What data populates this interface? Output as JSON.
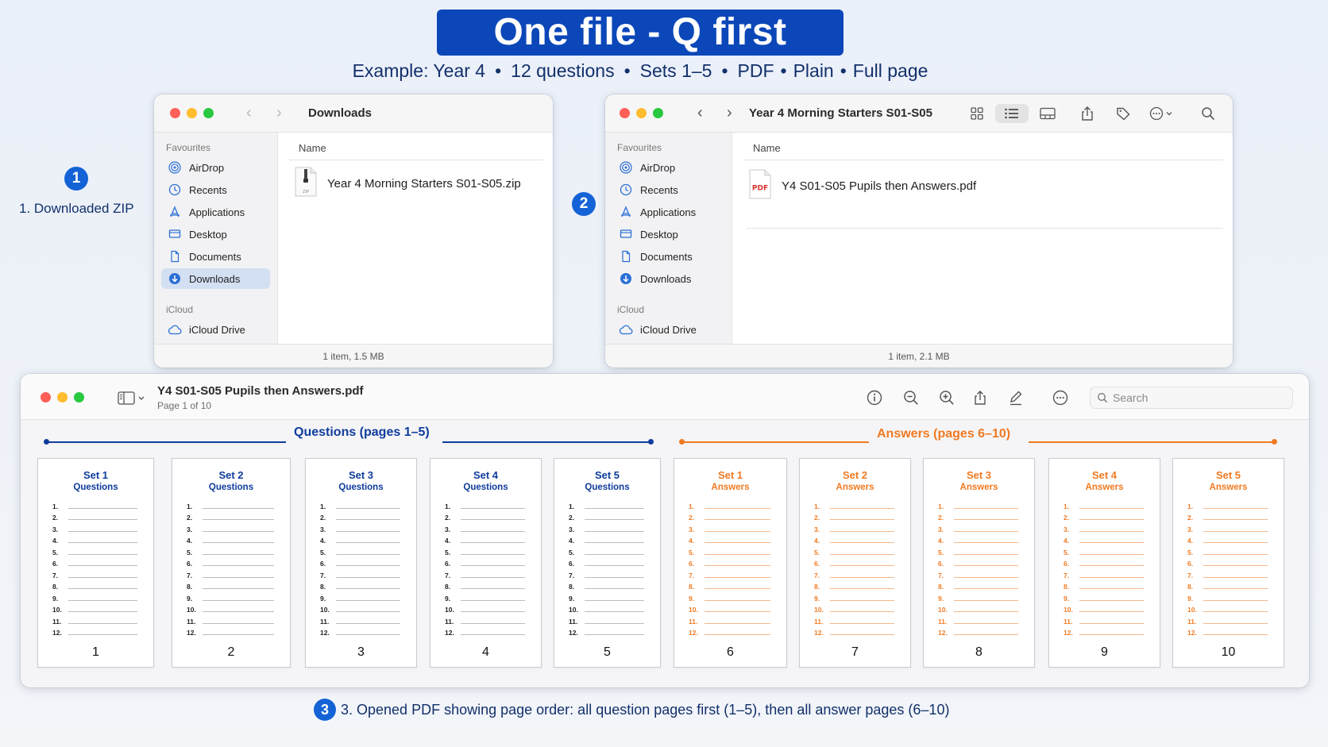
{
  "header": {
    "title": "One file - Q first",
    "subtitle_parts": [
      "Example: Year 4",
      "12 questions",
      "Sets 1–5",
      "PDF",
      "Plain",
      "Full page"
    ],
    "separator": "•"
  },
  "steps": {
    "one": {
      "number": "1",
      "label": "1. Downloaded ZIP"
    },
    "two": {
      "number": "2"
    },
    "three": {
      "number": "3",
      "label": "3. Opened PDF showing page order: all question pages first (1–5), then all answer pages (6–10)"
    }
  },
  "finder_left": {
    "title": "Downloads",
    "sidebar_favourites_heading": "Favourites",
    "sidebar_icloud_heading": "iCloud",
    "sidebar": [
      "AirDrop",
      "Recents",
      "Applications",
      "Desktop",
      "Documents",
      "Downloads"
    ],
    "icloud_drive": "iCloud Drive",
    "selected": "Downloads",
    "column_header": "Name",
    "file_name": "Year 4 Morning Starters S01-S05.zip",
    "file_icon_label": "ZIP",
    "status": "1 item, 1.5 MB"
  },
  "finder_right": {
    "title": "Year 4 Morning Starters S01-S05",
    "sidebar_favourites_heading": "Favourites",
    "sidebar_icloud_heading": "iCloud",
    "sidebar": [
      "AirDrop",
      "Recents",
      "Applications",
      "Desktop",
      "Documents",
      "Downloads"
    ],
    "icloud_drive": "iCloud Drive",
    "column_header": "Name",
    "file_name": "Y4 S01-S05 Pupils then Answers.pdf",
    "file_icon_label": "PDF",
    "status": "1 item, 2.1 MB"
  },
  "preview": {
    "title": "Y4 S01-S05 Pupils then Answers.pdf",
    "subtitle": "Page 1 of 10",
    "search_placeholder": "Search",
    "questions_label": "Questions (pages 1–5)",
    "answers_label": "Answers (pages 6–10)",
    "question_numbers": [
      "1.",
      "2.",
      "3.",
      "4.",
      "5.",
      "6.",
      "7.",
      "8.",
      "9.",
      "10.",
      "11.",
      "12."
    ],
    "pages": [
      {
        "title": "Set 1",
        "kind": "Questions",
        "number": "1"
      },
      {
        "title": "Set 2",
        "kind": "Questions",
        "number": "2"
      },
      {
        "title": "Set 3",
        "kind": "Questions",
        "number": "3"
      },
      {
        "title": "Set 4",
        "kind": "Questions",
        "number": "4"
      },
      {
        "title": "Set 5",
        "kind": "Questions",
        "number": "5"
      },
      {
        "title": "Set 1",
        "kind": "Answers",
        "number": "6"
      },
      {
        "title": "Set 2",
        "kind": "Answers",
        "number": "7"
      },
      {
        "title": "Set 3",
        "kind": "Answers",
        "number": "8"
      },
      {
        "title": "Set 4",
        "kind": "Answers",
        "number": "9"
      },
      {
        "title": "Set 5",
        "kind": "Answers",
        "number": "10"
      }
    ]
  },
  "colors": {
    "banner": "#0b47b8",
    "questions": "#0f3c9c",
    "answers": "#f07a22",
    "step": "#1463d6"
  }
}
